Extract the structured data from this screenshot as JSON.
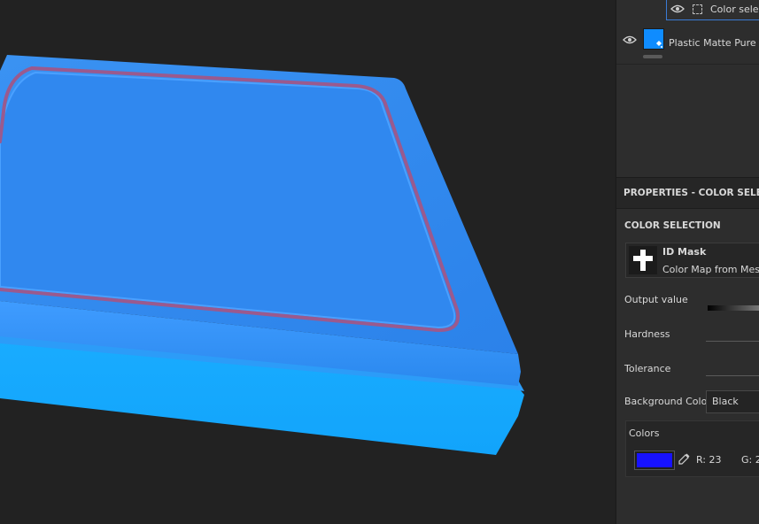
{
  "layers": [
    {
      "label": "Color select"
    },
    {
      "label": "Plastic Matte Pure",
      "thumb_color": "#0f8cff"
    }
  ],
  "properties": {
    "header": "PROPERTIES - COLOR SELEC",
    "section_title": "COLOR SELECTION",
    "mask": {
      "title": "ID Mask",
      "subtitle": "Color Map from Mesh D"
    },
    "output_value_label": "Output value",
    "hardness_label": "Hardness",
    "tolerance_label": "Tolerance",
    "background_color_label": "Background Color",
    "background_color_value": "Black",
    "colors": {
      "label": "Colors",
      "swatch_color": "#1712ff",
      "r_text": "R: 23",
      "g_text": "G: 2"
    }
  },
  "viewport": {
    "object_colors": {
      "top": "#2d8cf0",
      "side": "#16a8ff",
      "groove": "#9a5a8e"
    }
  }
}
